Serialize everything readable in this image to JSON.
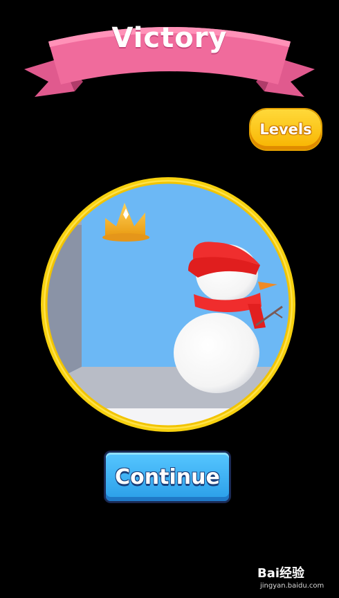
{
  "header": {
    "title": "Victory"
  },
  "buttons": {
    "levels_label": "Levels",
    "continue_label": "Continue"
  },
  "watermark": {
    "logo_text": "Bai经验",
    "url_text": "jingyan.baidu.com"
  },
  "colors": {
    "ribbon": "#f06b9c",
    "ribbon_dark": "#c84878",
    "levels_button": "#fbc524",
    "continue_button": "#3fb3f6",
    "scene_frame": "#f7d10f",
    "sky": "#6cb8f5",
    "floor": "#b8bcc6"
  },
  "scene": {
    "icons": [
      "crown-icon",
      "snowman-icon",
      "santa-hat-icon",
      "scarf-icon"
    ]
  }
}
